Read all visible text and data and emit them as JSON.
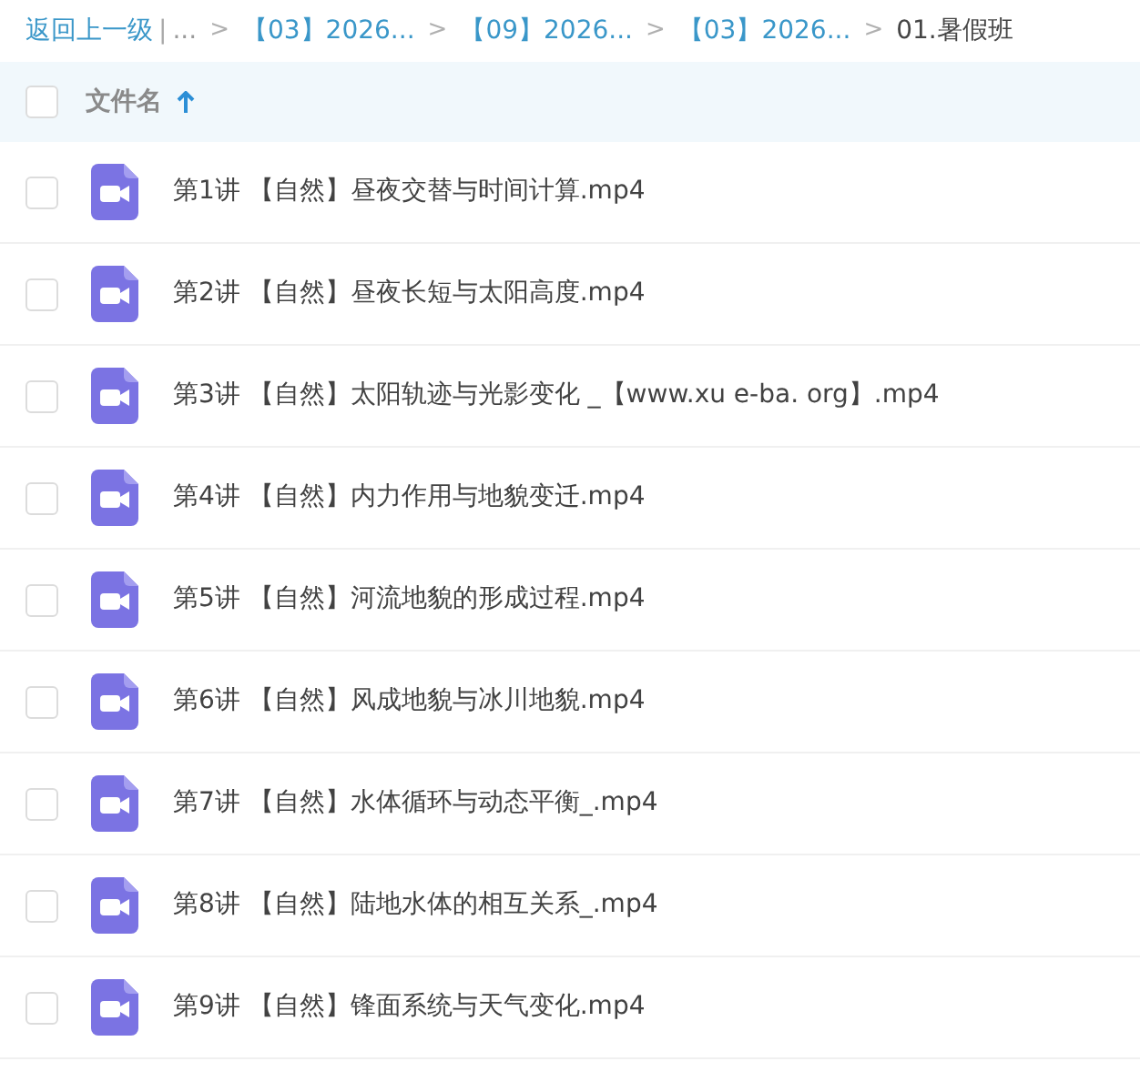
{
  "breadcrumb": {
    "back": "返回上一级",
    "divider": "|",
    "crumbs": [
      {
        "kind": "ellipsis",
        "label": "..."
      },
      {
        "kind": "link",
        "separator": ">",
        "label": "【03】2026..."
      },
      {
        "kind": "link",
        "separator": ">",
        "label": "【09】2026..."
      },
      {
        "kind": "link",
        "separator": ">",
        "label": "【03】2026..."
      },
      {
        "kind": "current",
        "separator": ">",
        "label": "01.暑假班"
      }
    ]
  },
  "header": {
    "checked": false,
    "column": "文件名",
    "sort_ascending": true
  },
  "files": [
    {
      "kind": "video",
      "checked": false,
      "name": "第1讲 【自然】昼夜交替与时间计算.mp4"
    },
    {
      "kind": "video",
      "checked": false,
      "name": "第2讲 【自然】昼夜长短与太阳高度.mp4"
    },
    {
      "kind": "video",
      "checked": false,
      "name": "第3讲 【自然】太阳轨迹与光影变化 _【www.xu e-ba. org】.mp4"
    },
    {
      "kind": "video",
      "checked": false,
      "name": "第4讲 【自然】内力作用与地貌变迁.mp4"
    },
    {
      "kind": "video",
      "checked": false,
      "name": "第5讲 【自然】河流地貌的形成过程.mp4"
    },
    {
      "kind": "video",
      "checked": false,
      "name": "第6讲 【自然】风成地貌与冰川地貌.mp4"
    },
    {
      "kind": "video",
      "checked": false,
      "name": "第7讲 【自然】水体循环与动态平衡_.mp4"
    },
    {
      "kind": "video",
      "checked": false,
      "name": "第8讲 【自然】陆地水体的相互关系_.mp4"
    },
    {
      "kind": "video",
      "checked": false,
      "name": "第9讲 【自然】锋面系统与天气变化.mp4"
    }
  ]
}
